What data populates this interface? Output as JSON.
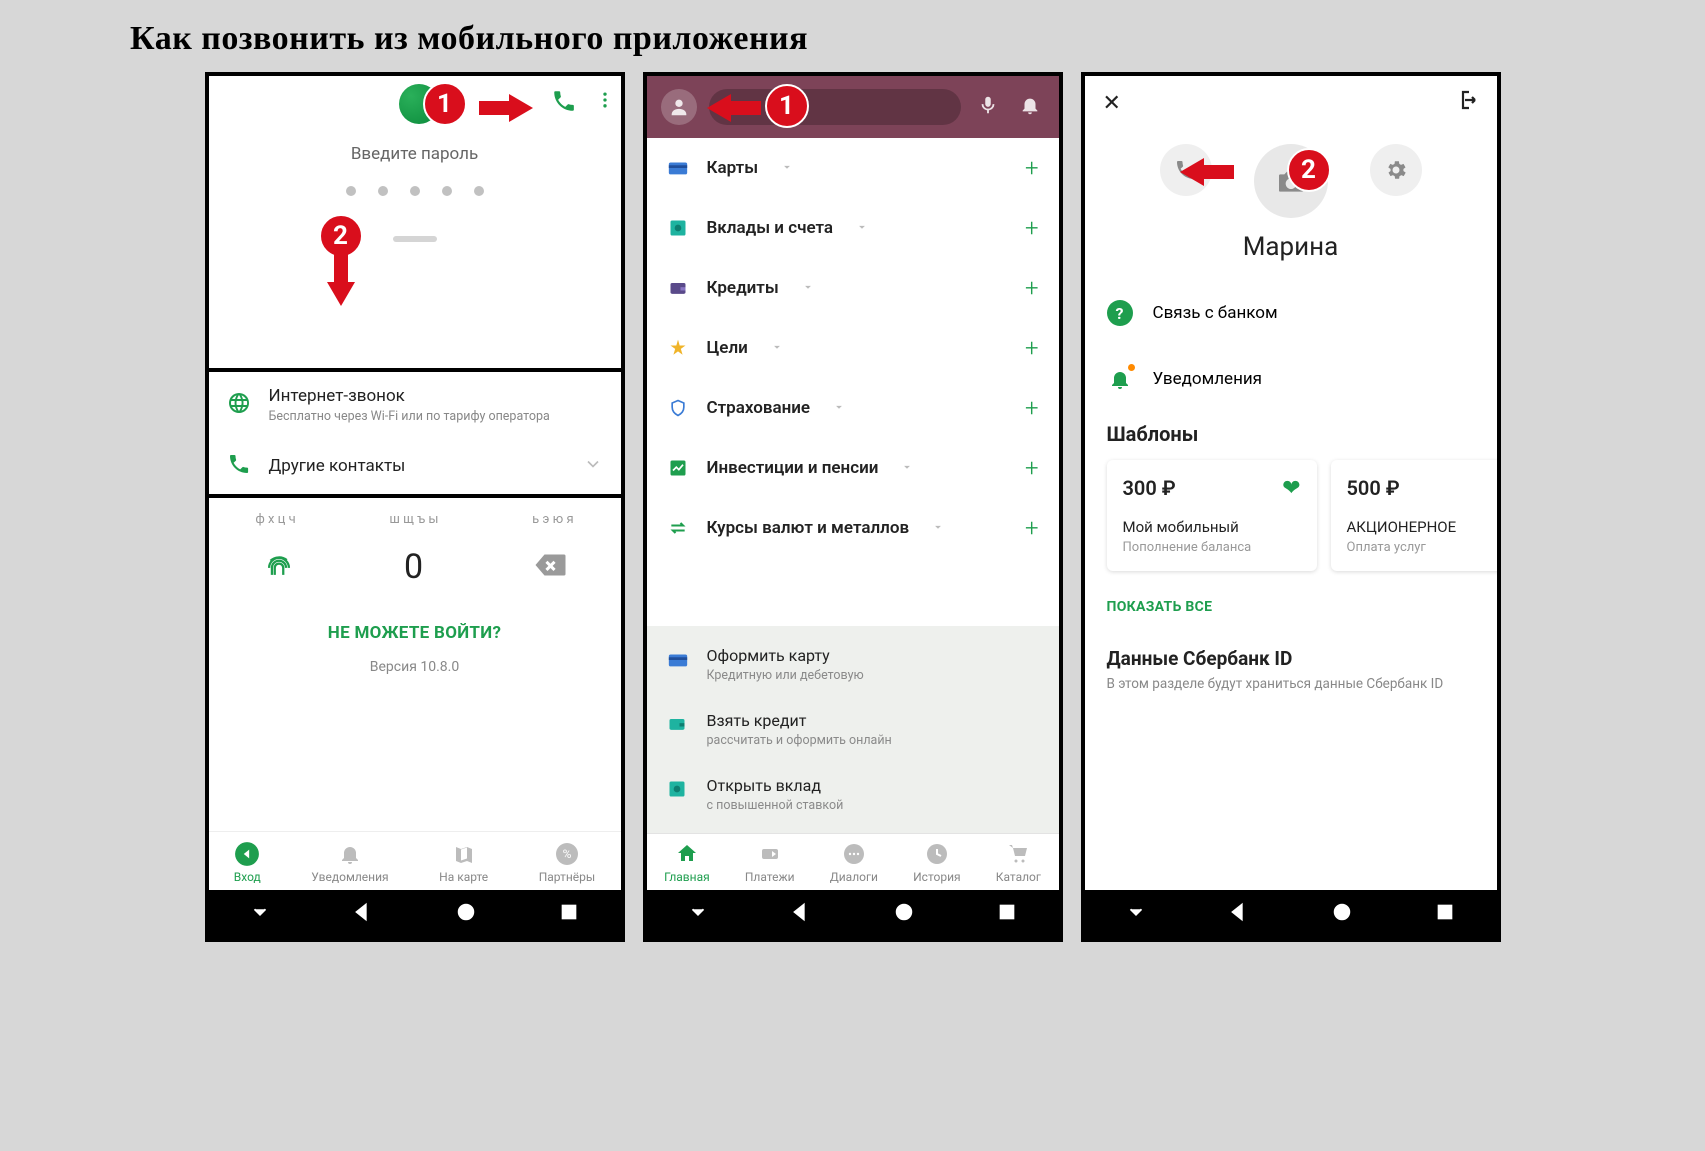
{
  "page_title": "Как позвонить из мобильного приложения",
  "annotations": {
    "badge1": "1",
    "badge2": "2"
  },
  "screen1": {
    "password_prompt": "Введите пароль",
    "internet_call": {
      "title": "Интернет-звонок",
      "subtitle": "Бесплатно через Wi-Fi или по тарифу оператора"
    },
    "other_contacts": "Другие контакты",
    "kb": {
      "c1": "ф х ц ч",
      "c2": "ш щ ъ ы",
      "c3": "ь э ю я"
    },
    "zero": "0",
    "cant_login": "НЕ МОЖЕТЕ ВОЙТИ?",
    "version": "Версия 10.8.0",
    "tabs": {
      "login": "Вход",
      "notifications": "Уведомления",
      "on_map": "На карте",
      "partners": "Партнёры"
    }
  },
  "screen2": {
    "sections": [
      {
        "icon": "cards",
        "label": "Карты"
      },
      {
        "icon": "safe",
        "label": "Вклады и счета"
      },
      {
        "icon": "wallet",
        "label": "Кредиты"
      },
      {
        "icon": "star",
        "label": "Цели"
      },
      {
        "icon": "shield",
        "label": "Страхование"
      },
      {
        "icon": "chart",
        "label": "Инвестиции и пенсии"
      },
      {
        "icon": "swap",
        "label": "Курсы валют и металлов"
      }
    ],
    "offers": [
      {
        "t1": "Оформить карту",
        "t2": "Кредитную или дебетовую"
      },
      {
        "t1": "Взять кредит",
        "t2": "рассчитать и оформить онлайн"
      },
      {
        "t1": "Открыть вклад",
        "t2": "с повышенной ставкой"
      }
    ],
    "tabs": {
      "home": "Главная",
      "payments": "Платежи",
      "dialogs": "Диалоги",
      "history": "История",
      "catalog": "Каталог"
    }
  },
  "screen3": {
    "name": "Марина",
    "contact_bank": "Связь с банком",
    "notifications": "Уведомления",
    "templates_h": "Шаблоны",
    "templates": [
      {
        "amount": "300 ₽",
        "t1": "Мой мобильный",
        "t2": "Пополнение баланса"
      },
      {
        "amount": "500 ₽",
        "t1": "АКЦИОНЕРНОЕ",
        "t2": "Оплата услуг"
      }
    ],
    "show_all": "ПОКАЗАТЬ ВСЕ",
    "sber_id": {
      "h": "Данные Сбербанк ID",
      "d": "В этом разделе будут храниться данные Сбербанк ID"
    }
  }
}
